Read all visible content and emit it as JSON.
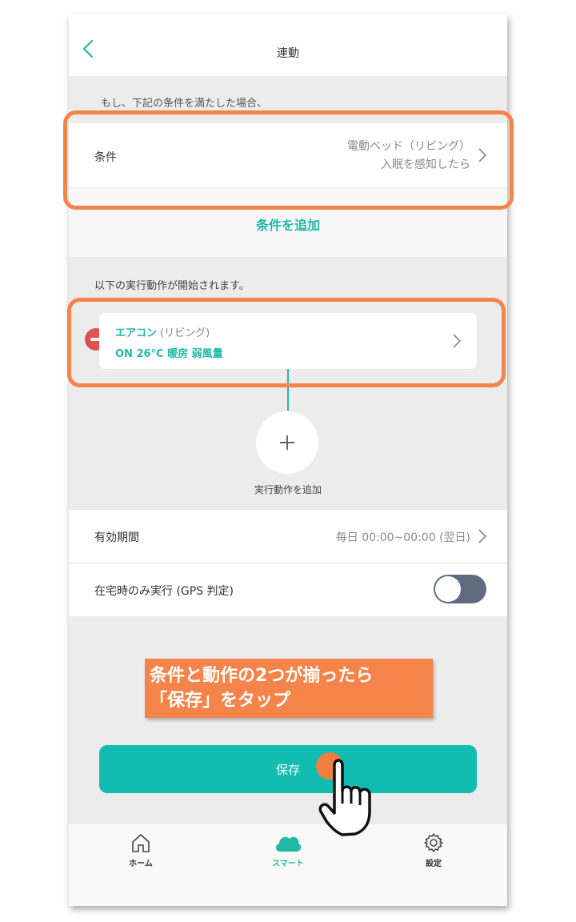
{
  "header": {
    "title": "連動"
  },
  "conditions": {
    "intro": "もし、下記の条件を満たした場合、",
    "label": "条件",
    "device": "電動ベッド（リビング）",
    "trigger": "入眠を感知したら",
    "add_label": "条件を追加"
  },
  "actions": {
    "intro": "以下の実行動作が開始されます。",
    "items": [
      {
        "name": "エアコン",
        "room": "(リビング)",
        "detail": "ON  26°C 暖房 弱風量"
      }
    ],
    "add_label": "実行動作を追加"
  },
  "settings": {
    "period_label": "有効期間",
    "period_value": "毎日 00:00~00:00 (翌日)",
    "gps_label": "在宅時のみ実行 (GPS 判定)",
    "gps_enabled": false
  },
  "callout": {
    "line1": "条件と動作の2つが揃ったら",
    "line2": "「保存」をタップ"
  },
  "save_label": "保存",
  "tabbar": {
    "items": [
      {
        "label": "ホーム",
        "icon": "home-icon"
      },
      {
        "label": "スマート",
        "icon": "cloud-icon",
        "active": true
      },
      {
        "label": "設定",
        "icon": "gear-icon"
      }
    ]
  },
  "colors": {
    "accent": "#22b8a6",
    "highlight": "#f5844a",
    "remove": "#e05252",
    "toggle": "#5f6c80"
  }
}
